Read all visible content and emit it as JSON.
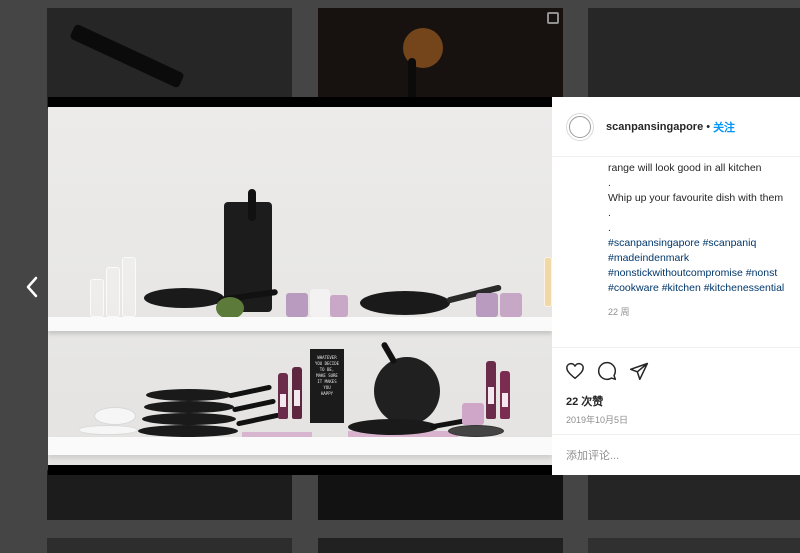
{
  "post": {
    "username": "scanpansingapore",
    "separator": "•",
    "follow_label": "关注",
    "caption_lines": [
      "range will look good in all kitchen",
      ".",
      "Whip up your favourite dish with them",
      ".",
      "."
    ],
    "hashtag_lines": [
      "#scanpansingapore #scanpaniq",
      "#madeindenmark",
      "#nonstickwithoutcompromise #nonst",
      "#cookware #kitchen #kitchenessential"
    ],
    "time_ago": "22 周",
    "likes": "22 次赞",
    "date": "2019年10月5日",
    "comment_placeholder": "添加评论..."
  },
  "photo": {
    "letterboard_lines": [
      "WHATEVER",
      "YOU DECIDE",
      "TO BE,",
      "MAKE SURE",
      "IT MAKES",
      "YOU",
      "HAPPY"
    ]
  },
  "icons": {
    "prev": "chevron-left-icon",
    "like": "heart-icon",
    "comment": "comment-icon",
    "share": "send-icon",
    "multi": "multi-image-icon"
  },
  "colors": {
    "accent": "#0095f6",
    "hashtag": "#00376b",
    "text": "#262626",
    "muted": "#8e8e8e",
    "backdrop": "#5a5a5a"
  }
}
